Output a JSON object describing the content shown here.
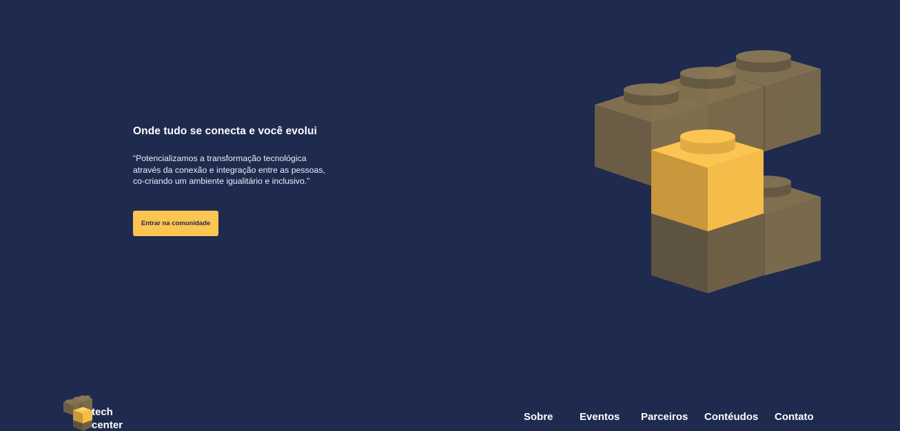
{
  "hero": {
    "title": "Onde tudo se conecta e você evolui",
    "quote_line1": "“Potencializamos a transformação tecnológica",
    "quote_line2": "através da conexão e integração entre as pessoas,",
    "quote_line3": "co-criando um ambiente igualitário e inclusivo.”",
    "cta_label": "Entrar na comunidade"
  },
  "illustration": {
    "icon": "lego-bricks-illustration"
  },
  "footer": {
    "brand_line1": "tech",
    "brand_line2": "center",
    "brand_icon": "lego-bricks-logo",
    "nav": [
      {
        "label": "Sobre"
      },
      {
        "label": "Eventos"
      },
      {
        "label": "Parceiros"
      },
      {
        "label": "Contéudos"
      },
      {
        "label": "Contato"
      }
    ]
  },
  "colors": {
    "background": "#1e2a4e",
    "accent": "#fcc450",
    "brick_muted": "#7a6b4e",
    "text": "#ffffff"
  }
}
